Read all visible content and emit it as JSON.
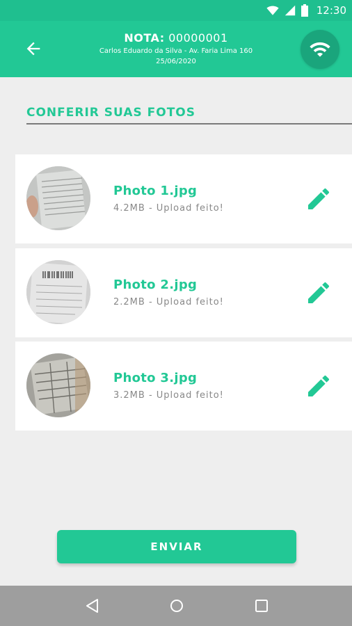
{
  "status_bar": {
    "time": "12:30",
    "icons": [
      "wifi-icon",
      "cell-signal-icon",
      "battery-icon"
    ]
  },
  "header": {
    "nota_label": "NOTA:",
    "nota_number": "00000001",
    "client_line": "Carlos Eduardo da Silva - Av. Faria Lima 160",
    "date": "25/06/2020",
    "back_icon": "arrow-back-icon",
    "connection_icon": "wifi-icon"
  },
  "section": {
    "title": "CONFERIR SUAS FOTOS"
  },
  "photos": [
    {
      "name": "Photo 1.jpg",
      "status": "4.2MB - Upload feito!",
      "action_icon": "pencil-icon"
    },
    {
      "name": "Photo 2.jpg",
      "status": "2.2MB - Upload feito!",
      "action_icon": "pencil-icon"
    },
    {
      "name": "Photo 3.jpg",
      "status": "3.2MB - Upload feito!",
      "action_icon": "pencil-icon"
    }
  ],
  "actions": {
    "send_label": "ENVIAR"
  },
  "nav_bar": {
    "icons": [
      "back-triangle-icon",
      "home-circle-icon",
      "recents-square-icon"
    ]
  },
  "colors": {
    "primary": "#22c895",
    "status_bar": "#1fbf8f",
    "wifi_button": "#1aa57c",
    "background": "#eeeeee",
    "card": "#ffffff",
    "secondary_text": "#888888",
    "nav_bar": "#9e9e9e"
  }
}
